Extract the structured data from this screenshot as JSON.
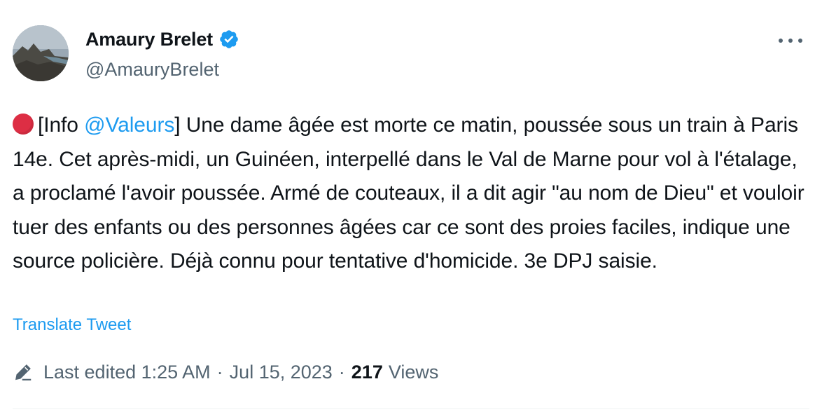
{
  "author": {
    "display_name": "Amaury Brelet",
    "handle": "@AmauryBrelet",
    "verified_icon": "verified-badge-icon",
    "avatar": "avatar-image"
  },
  "more_icon": "more-options-icon",
  "tweet": {
    "emoji_icon": "red-circle-emoji",
    "text_before_mention": "[Info ",
    "mention": "@Valeurs",
    "text_after_mention": "] Une dame âgée est morte ce matin, poussée sous un train à Paris 14e. Cet après-midi, un Guinéen, interpellé dans le Val de Marne pour vol à l'étalage, a proclamé l'avoir poussée. Armé de couteaux, il a dit agir \"au nom de Dieu\" et vouloir tuer des enfants ou des personnes âgées car ce sont des proies faciles, indique une source policière. Déjà connu pour tentative d'homicide. 3e DPJ saisie."
  },
  "translate_label": "Translate Tweet",
  "meta": {
    "edit_icon": "pencil-icon",
    "edited_label": "Last edited 1:25 AM",
    "separator": "·",
    "date": "Jul 15, 2023",
    "views_count": "217",
    "views_label": "Views"
  },
  "colors": {
    "accent": "#1d9bf0",
    "secondary_text": "#536471",
    "primary_text": "#0f1419",
    "emoji_red": "#dd2e44"
  }
}
